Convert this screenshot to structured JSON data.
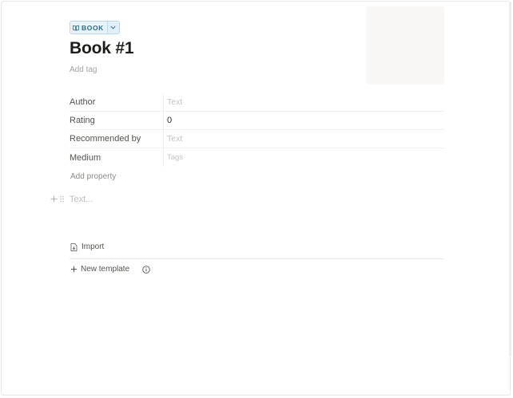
{
  "page": {
    "type_label": "BOOK",
    "title": "Book #1",
    "add_tag": "Add tag"
  },
  "properties": [
    {
      "name": "Author",
      "value": "Text",
      "is_placeholder": true
    },
    {
      "name": "Rating",
      "value": "0",
      "is_placeholder": false
    },
    {
      "name": "Recommended by",
      "value": "Text",
      "is_placeholder": true
    },
    {
      "name": "Medium",
      "value": "Tags",
      "is_placeholder": true
    }
  ],
  "add_property": "Add property",
  "body": {
    "text_placeholder": "Text..."
  },
  "footer": {
    "import_label": "Import",
    "new_template_label": "New template"
  },
  "icons": {
    "type": "book-icon",
    "dropdown": "chevron-down-icon",
    "add_block": "plus-icon",
    "drag": "drag-handle-icon",
    "import": "file-import-icon",
    "new_template": "plus-icon",
    "info": "info-icon"
  },
  "colors": {
    "type_pill_bg": "#e7f3f8",
    "type_pill_text": "#2f6e8f",
    "title_text": "#1f1e1b",
    "placeholder_text": "#c4c3bf"
  }
}
